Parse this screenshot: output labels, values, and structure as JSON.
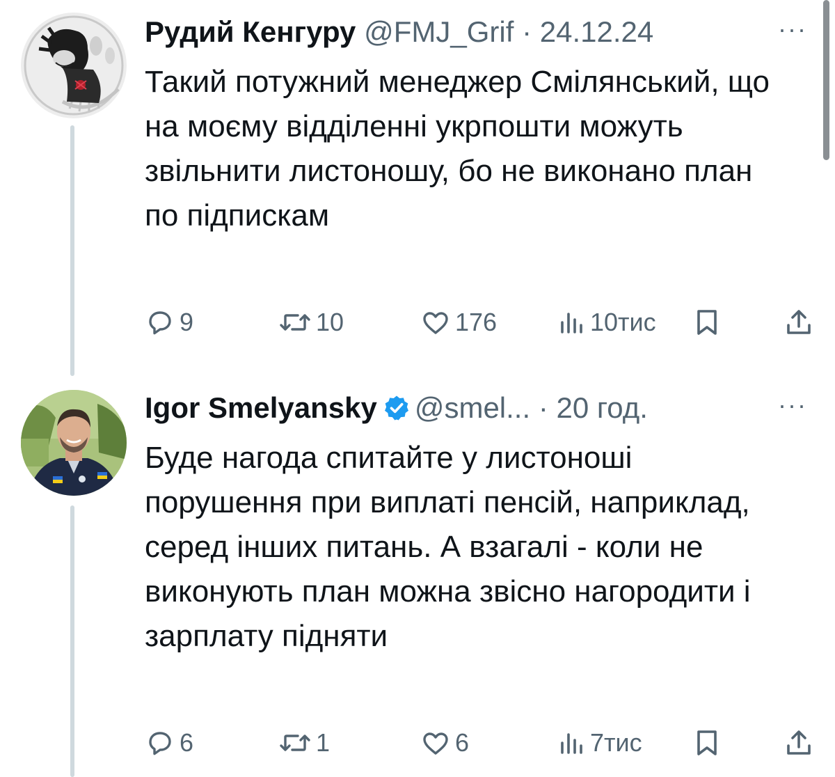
{
  "tweets": [
    {
      "author_name": "Рудий Кенгуру",
      "handle": "@FMJ_Grif",
      "separator": "·",
      "time": "24.12.24",
      "more": "···",
      "verified": false,
      "avatar": "cartoon-character-avatar",
      "text": "Такий потужний менеджер Смілянський, що на моєму відділенні укрпошти можуть звільнити листоношу, бо не виконано план по підпискам",
      "replies": "9",
      "retweets": "10",
      "likes": "176",
      "views": "10тис"
    },
    {
      "author_name": "Igor Smelyansky",
      "handle": "@smel...",
      "separator": "·",
      "time": "20 год.",
      "more": "···",
      "verified": true,
      "avatar": "man-photo-avatar",
      "text": "Буде нагода спитайте у листоноші порушення при виплаті пенсій, наприклад, серед інших питань. А взагалі - коли не виконують план можна звісно нагородити і зарплату підняти",
      "replies": "6",
      "retweets": "1",
      "likes": "6",
      "views": "7тис"
    }
  ],
  "colors": {
    "text": "#0f1419",
    "secondary": "#536471",
    "verified": "#1d9bf0",
    "thread_line": "#cfd9de"
  },
  "icons": [
    "reply-icon",
    "retweet-icon",
    "like-icon",
    "views-icon",
    "bookmark-icon",
    "share-icon",
    "verified-badge-icon",
    "more-icon"
  ]
}
